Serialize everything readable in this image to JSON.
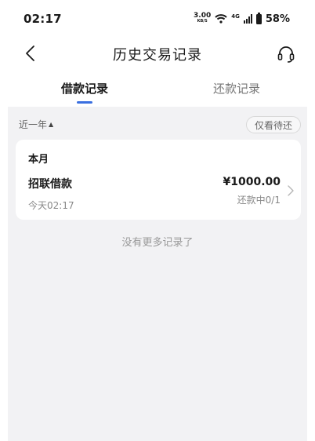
{
  "status_bar": {
    "time": "02:17",
    "net_speed_value": "3.00",
    "net_speed_unit": "KB/S",
    "network_type": "4G",
    "battery": "58%"
  },
  "nav": {
    "title": "历史交易记录",
    "back_icon": "chevron-left-icon",
    "service_icon": "headset-icon"
  },
  "tabs": {
    "borrow_label": "借款记录",
    "repay_label": "还款记录",
    "active": "borrow",
    "accent_color": "#3a6fe0"
  },
  "filter": {
    "period_label": "近一年",
    "only_pending_label": "仅看待还"
  },
  "records": {
    "month_label": "本月",
    "items": [
      {
        "name": "招联借款",
        "date": "今天02:17",
        "amount": "¥1000.00",
        "status": "还款中0/1"
      }
    ]
  },
  "footer_note": "没有更多记录了"
}
